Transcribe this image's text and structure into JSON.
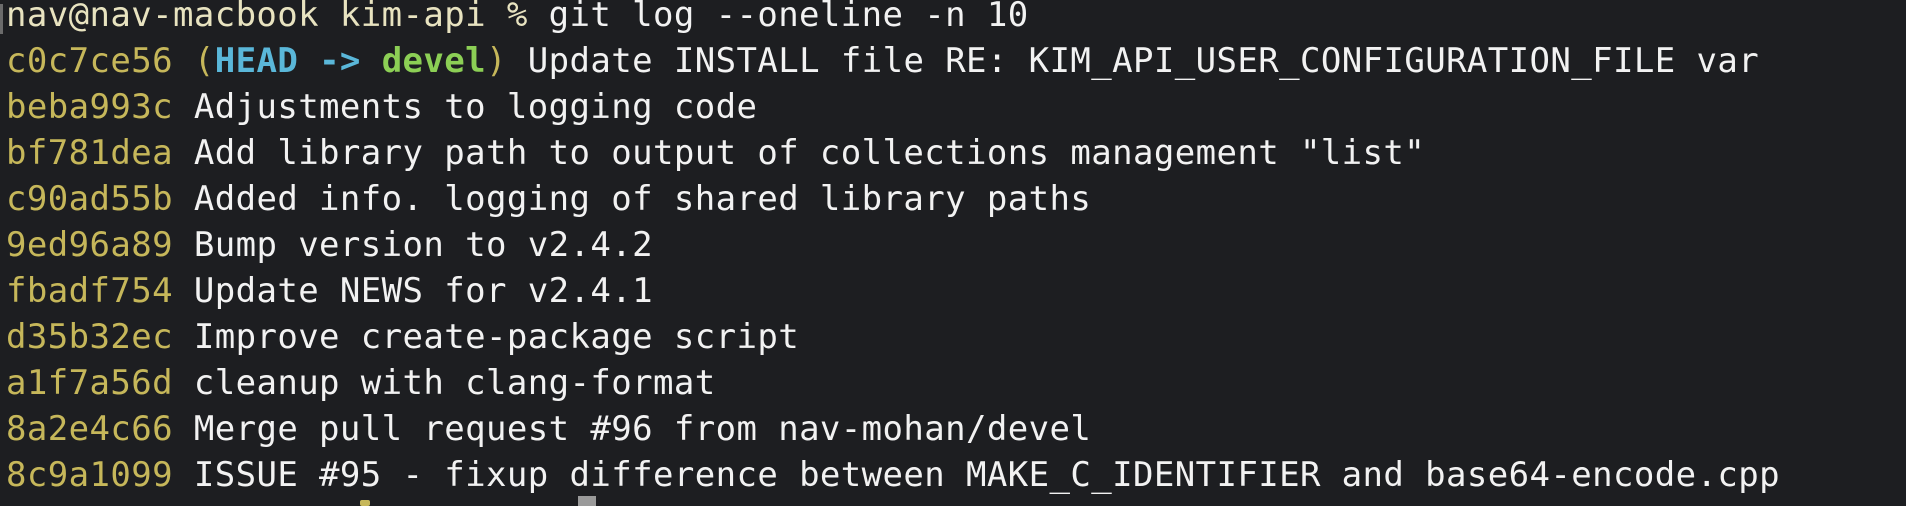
{
  "terminal": {
    "prompt": "nav@nav-macbook kim-api % ",
    "command": "git log --oneline -n 10",
    "head_decoration": {
      "open": "(",
      "head": "HEAD -> ",
      "branch": "devel",
      "close": ")"
    },
    "commits": [
      {
        "hash": "c0c7ce56",
        "message": "Update INSTALL file RE: KIM_API_USER_CONFIGURATION_FILE var"
      },
      {
        "hash": "beba993c",
        "message": "Adjustments to logging code"
      },
      {
        "hash": "bf781dea",
        "message": "Add library path to output of collections management \"list\""
      },
      {
        "hash": "c90ad55b",
        "message": "Added info. logging of shared library paths"
      },
      {
        "hash": "9ed96a89",
        "message": "Bump version to v2.4.2"
      },
      {
        "hash": "fbadf754",
        "message": "Update NEWS for v2.4.1"
      },
      {
        "hash": "d35b32ec",
        "message": "Improve create-package script"
      },
      {
        "hash": "a1f7a56d",
        "message": "cleanup with clang-format"
      },
      {
        "hash": "8a2e4c66",
        "message": "Merge pull request #96 from nav-mohan/devel"
      },
      {
        "hash": "8c9a1099",
        "message": "ISSUE #95 - fixup difference between MAKE_C_IDENTIFIER and base64-encode.cpp"
      }
    ],
    "colors": {
      "background": "#1d1e21",
      "hash": "#c6b75a",
      "head": "#5ab7d9",
      "branch": "#8ccf55",
      "text": "#f2f2f2"
    }
  }
}
